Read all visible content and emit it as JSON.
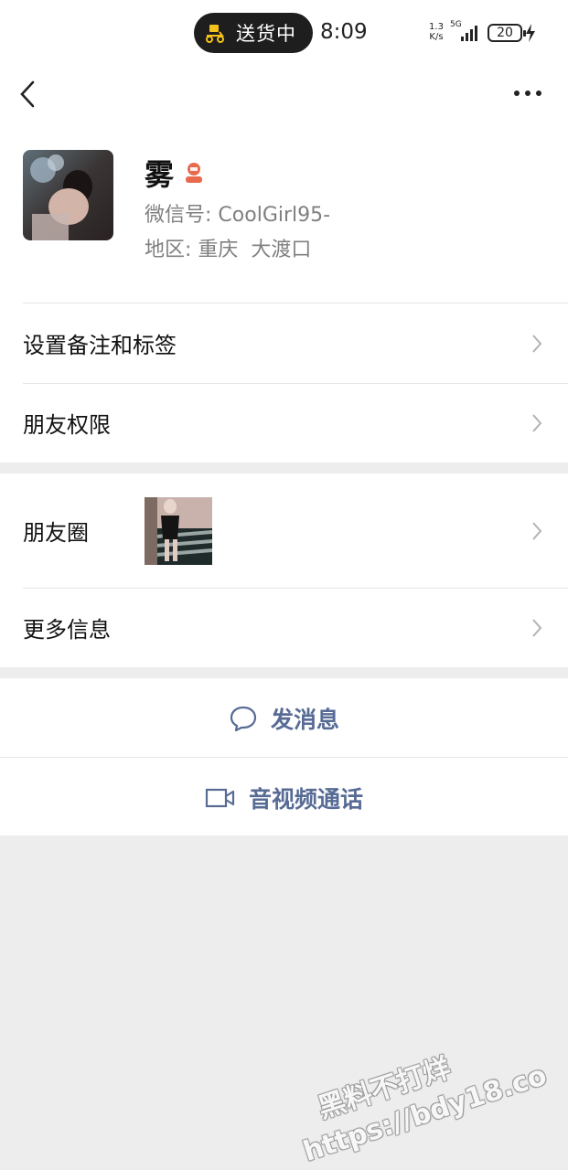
{
  "status_bar": {
    "pill_text": "送货中",
    "time": "8:09",
    "net_speed_value": "1.3",
    "net_speed_unit": "K/s",
    "network": "5G",
    "battery": "20"
  },
  "profile": {
    "name": "雾",
    "wechat_id_label": "微信号:",
    "wechat_id": "CoolGirl95-",
    "region_label": "地区:",
    "region": "重庆  大渡口"
  },
  "menu": {
    "set_remark": "设置备注和标签",
    "friend_permission": "朋友权限",
    "moments": "朋友圈",
    "more_info": "更多信息"
  },
  "actions": {
    "send_message": "发消息",
    "video_call": "音视频通话"
  },
  "watermark": {
    "line1": "黑料不打烊",
    "line2": "https://bdy18.co"
  },
  "colors": {
    "link": "#576b95",
    "background": "#ededed",
    "gender_female": "#e86a4e"
  }
}
